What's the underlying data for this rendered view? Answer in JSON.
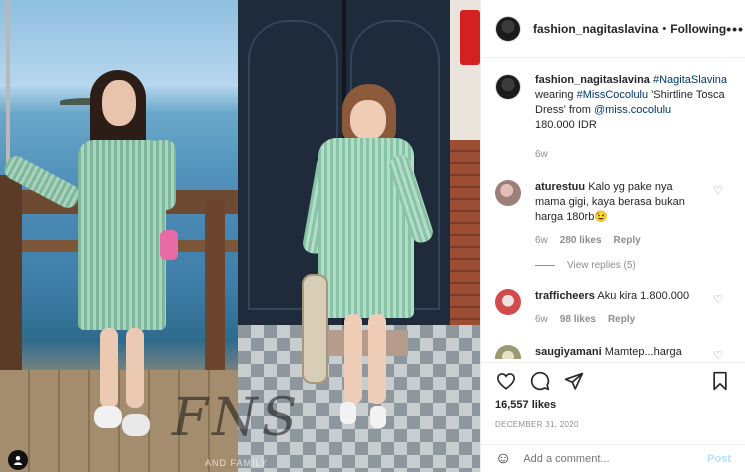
{
  "post": {
    "username": "fashion_nagitaslavina",
    "separator": "•",
    "following_label": "Following",
    "more_label": "•••",
    "watermark": "FNS",
    "watermark_small": "AND FAMILY"
  },
  "caption": {
    "username": "fashion_nagitaslavina",
    "hashtag1": "#NagitaSlavina",
    "text1": "wearing",
    "hashtag2": "#MissCocolulu",
    "text2": "'Shirtline Tosca Dress' from",
    "mention": "@miss.cocolulu",
    "price": "180.000 IDR",
    "time": "6w"
  },
  "comments": [
    {
      "username": "aturestuu",
      "text": "Kalo yg pake nya mama gigi, kaya berasa bukan harga 180rb😉",
      "time": "6w",
      "likes": "280 likes",
      "reply": "Reply",
      "view_replies": "View replies (5)",
      "avatar_color": "#c9a5a0"
    },
    {
      "username": "trafficheers",
      "text": "Aku kira 1.800.000",
      "time": "6w",
      "likes": "98 likes",
      "reply": "Reply",
      "avatar_color": "#d14b4b"
    },
    {
      "username": "saugiyamani",
      "text": "Mamtep...harga",
      "avatar_color": "#b9b99a"
    }
  ],
  "stats": {
    "likes": "16,557 likes",
    "date": "DECEMBER 31, 2020"
  },
  "composer": {
    "placeholder": "Add a comment...",
    "post_label": "Post"
  },
  "icons": [
    "heart-icon",
    "comment-icon",
    "share-icon",
    "bookmark-icon",
    "emoji-icon",
    "tag-user-icon"
  ]
}
